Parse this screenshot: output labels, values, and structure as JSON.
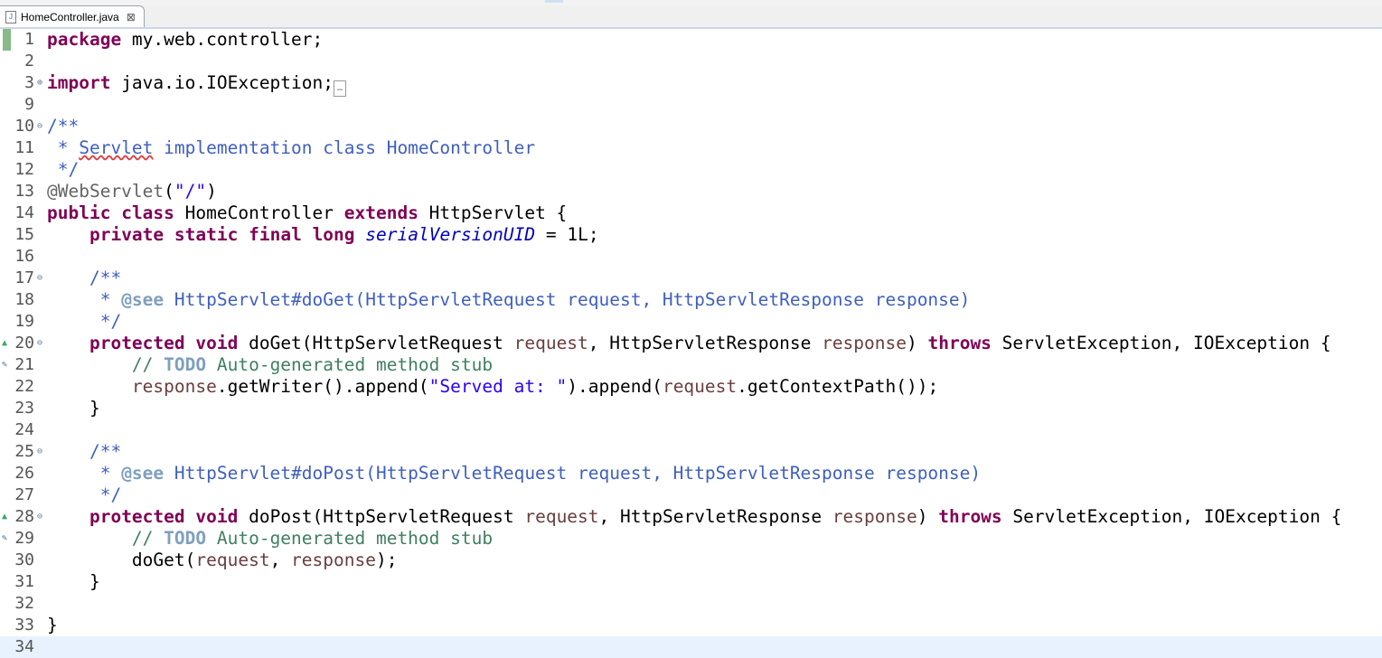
{
  "tab": {
    "label": "HomeController.java",
    "icon": "java-file-icon",
    "close": "⊠"
  },
  "lines": [
    {
      "n": "1",
      "fold": "",
      "gutter": "",
      "html": "<span class=\"kw\">package</span> my.web.controller;"
    },
    {
      "n": "2",
      "fold": "",
      "gutter": "",
      "html": ""
    },
    {
      "n": "3",
      "fold": "⊕",
      "gutter": "",
      "html": "<span class=\"kw\">import</span> java.io.IOException;<span class=\"box\">…</span>"
    },
    {
      "n": "9",
      "fold": "",
      "gutter": "",
      "html": ""
    },
    {
      "n": "10",
      "fold": "⊖",
      "gutter": "",
      "html": "<span class=\"cm\">/**</span>"
    },
    {
      "n": "11",
      "fold": "",
      "gutter": "",
      "html": "<span class=\"cm\"> * <span class=\"err\">Servlet</span> implementation class HomeController</span>"
    },
    {
      "n": "12",
      "fold": "",
      "gutter": "",
      "html": "<span class=\"cm\"> */</span>"
    },
    {
      "n": "13",
      "fold": "",
      "gutter": "",
      "html": "<span class=\"ann\">@WebServlet</span>(<span class=\"str\">\"/\"</span>)"
    },
    {
      "n": "14",
      "fold": "",
      "gutter": "",
      "html": "<span class=\"kw\">public</span> <span class=\"kw\">class</span> HomeController <span class=\"kw\">extends</span> HttpServlet {"
    },
    {
      "n": "15",
      "fold": "",
      "gutter": "",
      "html": "    <span class=\"kw\">private</span> <span class=\"kw\">static</span> <span class=\"kw\">final</span> <span class=\"kw\">long</span> <span class=\"fld\">serialVersionUID</span> = 1L;"
    },
    {
      "n": "16",
      "fold": "",
      "gutter": "",
      "html": ""
    },
    {
      "n": "17",
      "fold": "⊖",
      "gutter": "",
      "html": "    <span class=\"cm\">/**</span>"
    },
    {
      "n": "18",
      "fold": "",
      "gutter": "",
      "html": "<span class=\"cm\">     * <b style=\"color:#7f9fbf\">@see</b> HttpServlet#doGet(HttpServletRequest request, HttpServletResponse response)</span>"
    },
    {
      "n": "19",
      "fold": "",
      "gutter": "",
      "html": "<span class=\"cm\">     */</span>"
    },
    {
      "n": "20",
      "fold": "⊖",
      "gutter": "▲",
      "html": "    <span class=\"kw\">protected</span> <span class=\"kw\">void</span> doGet(HttpServletRequest <span class=\"par\">request</span>, HttpServletResponse <span class=\"par\">response</span>) <span class=\"kw\">throws</span> ServletException, IOException {"
    },
    {
      "n": "21",
      "fold": "",
      "gutter": "✎",
      "html": "        <span class=\"cm2\">// <span class=\"todo\">TODO</span> Auto-generated method stub</span>"
    },
    {
      "n": "22",
      "fold": "",
      "gutter": "",
      "html": "        <span class=\"par\">response</span>.getWriter().append(<span class=\"str\">\"Served at: \"</span>).append(<span class=\"par\">request</span>.getContextPath());"
    },
    {
      "n": "23",
      "fold": "",
      "gutter": "",
      "html": "    }"
    },
    {
      "n": "24",
      "fold": "",
      "gutter": "",
      "html": ""
    },
    {
      "n": "25",
      "fold": "⊖",
      "gutter": "",
      "html": "    <span class=\"cm\">/**</span>"
    },
    {
      "n": "26",
      "fold": "",
      "gutter": "",
      "html": "<span class=\"cm\">     * <b style=\"color:#7f9fbf\">@see</b> HttpServlet#doPost(HttpServletRequest request, HttpServletResponse response)</span>"
    },
    {
      "n": "27",
      "fold": "",
      "gutter": "",
      "html": "<span class=\"cm\">     */</span>"
    },
    {
      "n": "28",
      "fold": "⊖",
      "gutter": "▲",
      "html": "    <span class=\"kw\">protected</span> <span class=\"kw\">void</span> doPost(HttpServletRequest <span class=\"par\">request</span>, HttpServletResponse <span class=\"par\">response</span>) <span class=\"kw\">throws</span> ServletException, IOException {"
    },
    {
      "n": "29",
      "fold": "",
      "gutter": "✎",
      "html": "        <span class=\"cm2\">// <span class=\"todo\">TODO</span> Auto-generated method stub</span>"
    },
    {
      "n": "30",
      "fold": "",
      "gutter": "",
      "html": "        doGet(<span class=\"par\">request</span>, <span class=\"par\">response</span>);"
    },
    {
      "n": "31",
      "fold": "",
      "gutter": "",
      "html": "    }"
    },
    {
      "n": "32",
      "fold": "",
      "gutter": "",
      "html": ""
    },
    {
      "n": "33",
      "fold": "",
      "gutter": "",
      "html": "}"
    },
    {
      "n": "34",
      "fold": "",
      "gutter": "",
      "html": ""
    }
  ]
}
